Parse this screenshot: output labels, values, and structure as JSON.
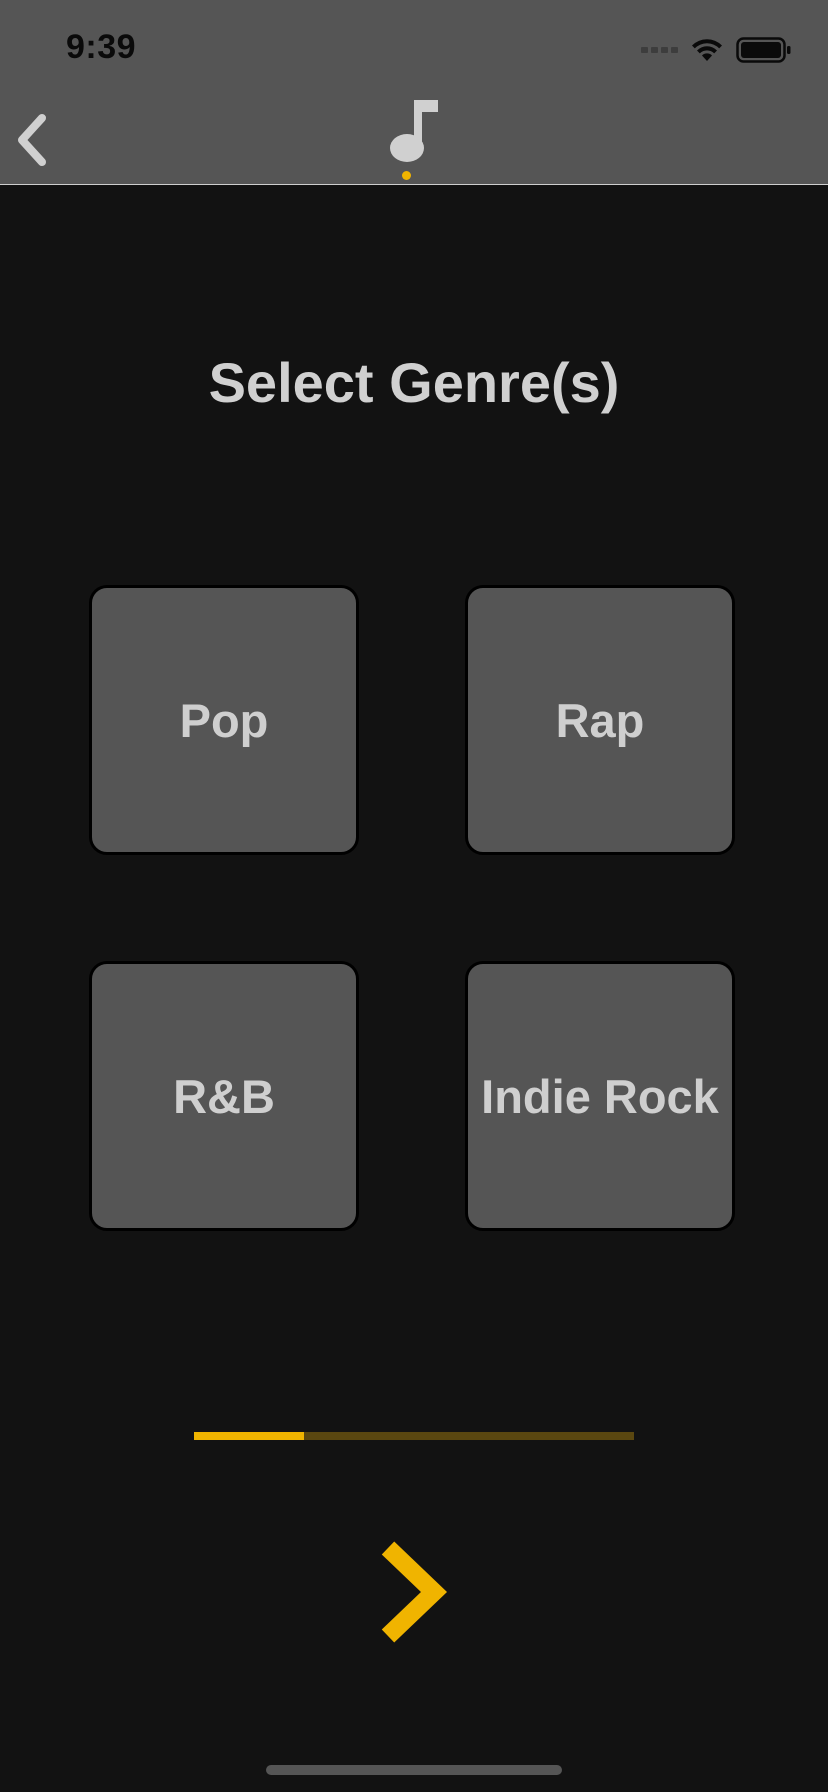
{
  "status_bar": {
    "time": "9:39"
  },
  "header": {
    "back_icon": "chevron-left-icon",
    "center_icon": "music-note-icon",
    "page_indicator_color": "#f0b400"
  },
  "main": {
    "title": "Select Genre(s)",
    "genres": [
      {
        "label": "Pop"
      },
      {
        "label": "Rap"
      },
      {
        "label": "R&B"
      },
      {
        "label": "Indie Rock"
      }
    ]
  },
  "progress": {
    "value": 0.25,
    "fill_color": "#f0b400",
    "track_color": "#5a4710"
  },
  "footer": {
    "next_icon": "chevron-right-icon",
    "next_color": "#f0b400"
  }
}
